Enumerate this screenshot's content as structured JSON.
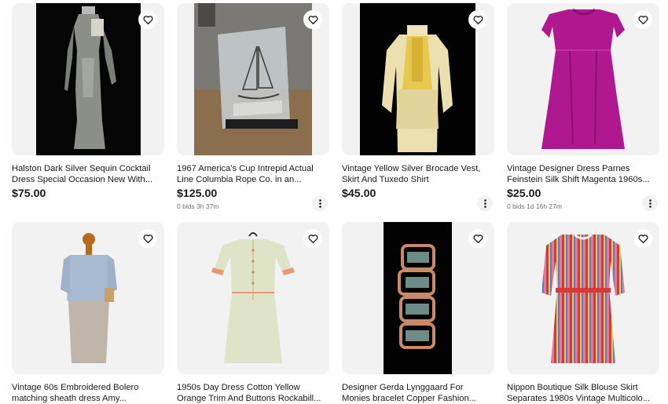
{
  "listings": [
    {
      "title": "Halston Dark Silver Sequin Cocktail Dress Special Occasion New With...",
      "price": "$75.00",
      "bids": "",
      "image": "silver-sequin-dress-photo"
    },
    {
      "title": "1967 America's Cup Intrepid Actual Line Columbia Rope Co. in an...",
      "price": "$125.00",
      "bids": "0 bids 3h 37m",
      "image": "lucite-sailboat-trophy-photo"
    },
    {
      "title": "Vintage Yellow Silver Brocade Vest, Skirt And Tuxedo Shirt",
      "price": "$45.00",
      "bids": "",
      "image": "yellow-brocade-vest-photo"
    },
    {
      "title": "Vintage Designer Dress Parnes Feinstein Silk Shift Magenta 1960s...",
      "price": "$25.00",
      "bids": "0 bids 1d 16h 27m",
      "image": "magenta-silk-dress-photo"
    },
    {
      "title": "Vintage 60s Embroidered Bolero matching sheath dress Amy...",
      "price": "",
      "bids": "",
      "image": "blue-bolero-dress-photo"
    },
    {
      "title": "1950s Day Dress Cotton Yellow Orange Trim And Buttons Rockabill...",
      "price": "",
      "bids": "",
      "image": "yellow-day-dress-photo"
    },
    {
      "title": "Designer Gerda Lynggaard For Monies bracelet Copper Fashion...",
      "price": "",
      "bids": "",
      "image": "copper-bracelet-photo"
    },
    {
      "title": "Nippon Boutique Silk Blouse Skirt Separates 1980s Vintage Multicolo...",
      "price": "",
      "bids": "",
      "image": "striped-silk-outfit-photo"
    }
  ],
  "icons": {
    "watch": "heart-icon",
    "more": "more-vertical-icon"
  },
  "colors": {
    "text": "#191919",
    "secondary": "#707070",
    "tile_bg": "#f2f2f2"
  }
}
